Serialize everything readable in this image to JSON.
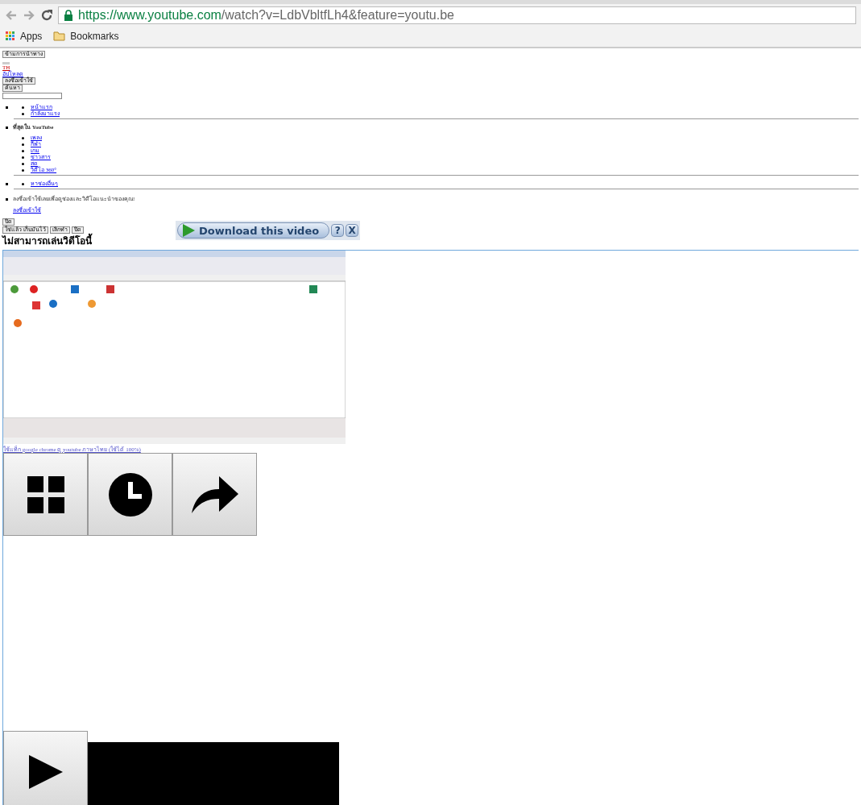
{
  "browser": {
    "url_host": "https://www.youtube.com",
    "url_path": "/watch?v=LdbVbltfLh4&feature=youtu.be",
    "bookmarks": [
      {
        "label": "Apps",
        "kind": "apps"
      },
      {
        "label": "Bookmarks",
        "kind": "folder"
      }
    ]
  },
  "masthead": {
    "skip_button": "ข้ามการนำทาง",
    "language": "TH",
    "upload": "อัปโหลด",
    "sign_in_button": "ลงชื่อเข้าใช้",
    "search_button": "ค้นหา"
  },
  "guide": [
    {
      "items": [
        "หน้าแรก",
        "กำลังมาแรง"
      ]
    },
    {
      "heading": "ที่สุดใน YouTube",
      "items": [
        "เพลง",
        "กีฬา",
        "เกม",
        "ข่าวสาร",
        "สด",
        "วิดีโอ 360°"
      ]
    },
    {
      "items": [
        "หาช่องอื่นๆ"
      ]
    }
  ],
  "sign_in_prompt": {
    "text": "ลงชื่อเข้าใช้เลยเพื่อดูช่องและวิดีโอแนะนำของคุณ!",
    "link": "ลงชื่อเข้าใช้"
  },
  "buttons_row1": [
    "ปิด"
  ],
  "buttons_row2": [
    "ใช่แล้ว เก็บมันไว้",
    "เลิกทำ",
    "ปิด"
  ],
  "player_error": "ไม่สามารถเล่นวิดีโอนี้",
  "download_overlay": {
    "label": "Download this video",
    "help": "?",
    "close": "X"
  },
  "caption_link": "ใช้แท็ก google chrome ดู youtube ภาษาไทย (ใช้ได้ 100%)",
  "action_buttons": [
    {
      "kind": "grid"
    },
    {
      "kind": "clock"
    },
    {
      "kind": "share"
    }
  ]
}
